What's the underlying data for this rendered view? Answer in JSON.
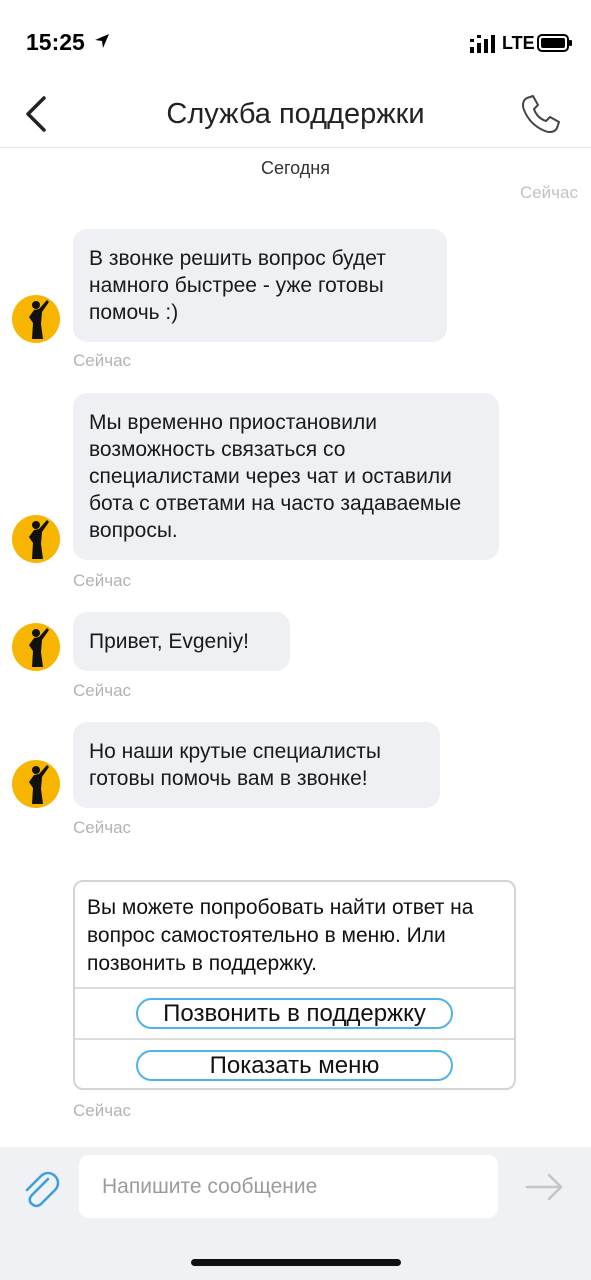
{
  "status_bar": {
    "time": "15:25",
    "network": "LTE"
  },
  "header": {
    "title": "Служба поддержки"
  },
  "chat": {
    "date_separator": "Сегодня",
    "ghost_timestamp": "Сейчас",
    "messages": [
      {
        "text": "В звонке решить вопрос будет намного быстрее - уже готовы помочь :)",
        "time": "Сейчас"
      },
      {
        "text": "Мы временно приостановили возможность связаться со специалистами через чат и оставили бота с ответами на часто задаваемые вопросы.",
        "time": "Сейчас"
      },
      {
        "text": "Привет, Evgeniy!",
        "time": "Сейчас"
      },
      {
        "text": "Но наши крутые специалисты готовы помочь вам в звонке!",
        "time": "Сейчас"
      }
    ],
    "options_card": {
      "text": "Вы можете попробовать найти ответ на вопрос самостоятельно в меню. Или позвонить в поддержку.",
      "buttons": [
        {
          "label": "Позвонить в поддержку"
        },
        {
          "label": "Показать меню"
        }
      ],
      "time": "Сейчас"
    }
  },
  "composer": {
    "placeholder": "Напишите сообщение"
  },
  "colors": {
    "avatar": "#f7b500",
    "accent": "#4fb3e8",
    "bubble": "#eef0f4"
  },
  "icons": [
    "location-arrow-icon",
    "signal-icon",
    "battery-icon",
    "back-chevron-icon",
    "phone-icon",
    "paperclip-icon",
    "send-arrow-icon"
  ]
}
